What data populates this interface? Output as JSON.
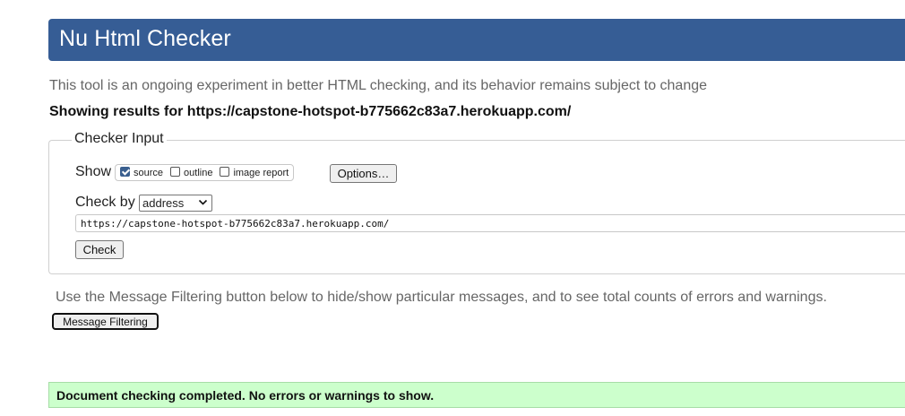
{
  "header": {
    "title": "Nu Html Checker"
  },
  "intro": {
    "subtitle": "This tool is an ongoing experiment in better HTML checking, and its behavior remains subject to change",
    "results_for": "Showing results for https://capstone-hotspot-b775662c83a7.herokuapp.com/"
  },
  "checker_input": {
    "legend": "Checker Input",
    "show_label": "Show",
    "show_options": [
      {
        "label": "source",
        "checked": true
      },
      {
        "label": "outline",
        "checked": false
      },
      {
        "label": "image report",
        "checked": false
      }
    ],
    "options_button": "Options…",
    "check_by_label": "Check by",
    "check_by_selected": "address",
    "url_value": "https://capstone-hotspot-b775662c83a7.herokuapp.com/",
    "check_button": "Check"
  },
  "filtering": {
    "note": "Use the Message Filtering button below to hide/show particular messages, and to see total counts of errors and warnings.",
    "button": "Message Filtering"
  },
  "result": {
    "message": "Document checking completed. No errors or warnings to show.",
    "color": "#ccffcc"
  },
  "colors": {
    "brand": "#365d95"
  }
}
